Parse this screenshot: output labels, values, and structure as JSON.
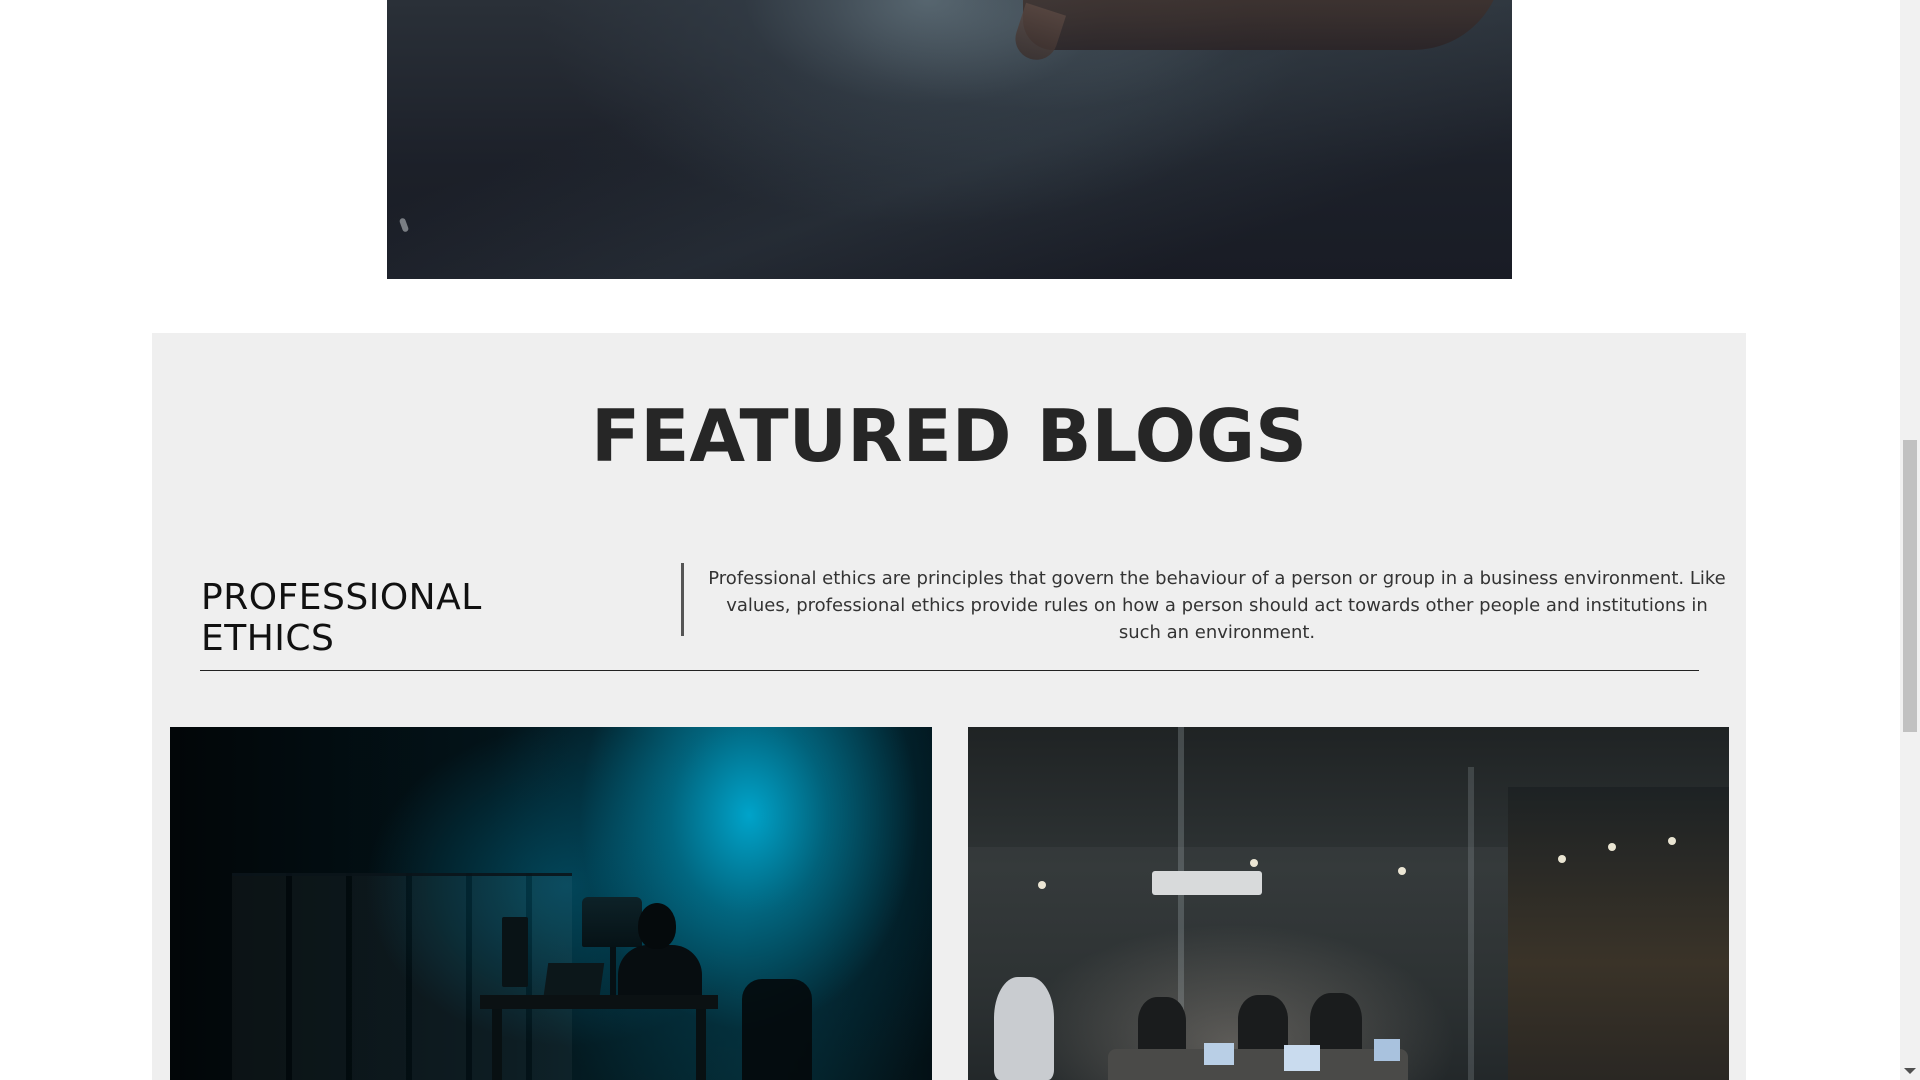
{
  "hero": {
    "image_alt": "hand-on-dark-desk-image"
  },
  "featured": {
    "title": "FEATURED BLOGS",
    "topic": {
      "name": "PROFESSIONAL ETHICS",
      "description": "Professional ethics are principles that govern the behaviour of a person or group in a business environment. Like values, professional ethics provide rules on how a person should act towards other people and institutions in such an environment."
    },
    "cards": [
      {
        "image": "hacker-at-desk-image"
      },
      {
        "image": "office-meeting-image"
      }
    ]
  },
  "colors": {
    "section_background": "#efefef",
    "title_color": "#262626",
    "divider_color": "#555555",
    "rule_color": "#222222"
  },
  "icons": {
    "scroll_down": "chevron-down-icon"
  }
}
